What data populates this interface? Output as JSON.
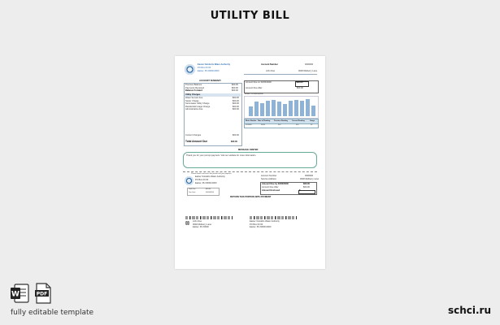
{
  "page_title": "UTILITY BILL",
  "footer": {
    "left_text": "fully editable template",
    "site": "schci.ru"
  },
  "icons": {
    "word": "word-icon",
    "pdf": "pdf-icon"
  },
  "doc": {
    "company_name": "Easter Outskirts Water Authority",
    "company_address": "PO Box 00 00",
    "company_city": "Easter, Pk 00000-0000",
    "account_number_label": "Account Number",
    "account_number_value": "0000000",
    "customer_name": "John Doe",
    "customer_address": "0000 Mulberry Lane",
    "account_summary_title": "ACCOUNT SUMMARY",
    "summary_rows": [
      {
        "label": "Previous Balance",
        "value": "$00.00"
      },
      {
        "label": "Payments Received",
        "value": "$00.00"
      },
      {
        "label": "Balance Forward",
        "value": "$00.00"
      }
    ],
    "charges_title": "Utility Charges",
    "charges_rows": [
      {
        "label": "Water Service Fee",
        "value": "$00.00"
      },
      {
        "label": "Sewer Charge",
        "value": "$00.00"
      },
      {
        "label": "Stormwater Utility Charge",
        "value": "$00.00"
      },
      {
        "label": "Residential Usage Charge",
        "value": "$00.00"
      },
      {
        "label": "Administrative Fee",
        "value": "$00.00"
      }
    ],
    "current_charges_label": "Current Charges",
    "current_charges_value": "$00.00",
    "total_due_label": "Total Amount Due",
    "total_due_value": "$00.00",
    "amount_due_label": "Amount Due on 00/00/0000",
    "amount_due_value": "$00.00",
    "amount_after_label": "Amount Due After",
    "amount_after_value": "$00.00",
    "usage_title": "Water Consumption",
    "usage_bars": [
      0.55,
      0.8,
      0.75,
      0.85,
      0.9,
      0.8,
      0.7,
      0.85,
      0.9,
      0.88,
      0.95,
      0.6
    ],
    "usage_table_headers": [
      "Meter Number",
      "Date of Reading",
      "Previous Reading",
      "Current Reading",
      "Usage"
    ],
    "usage_table_values": [
      "0000000",
      "00/00",
      "000",
      "000",
      "00"
    ],
    "message_title": "MESSAGE CENTER",
    "message_text": "Thank you for your prompt payment. Visit our website for more information.",
    "cut_line": "Please detach and return this portion with your payment",
    "stub_company_name": "Easter Outskirts Water Authority",
    "stub_address": "PO Box 00 00",
    "stub_city": "Easter, Pk 00000-0000",
    "stub_account_label": "Account Number",
    "stub_account_value": "0000000",
    "stub_service_label": "Service Address",
    "stub_service_value": "0000 Mulberry Lane",
    "stub_due_label": "Amount Due by 00/00/0000",
    "stub_due_value": "$00.00",
    "stub_after_label": "Amount Due After",
    "stub_after_value": "$00.00",
    "stub_enclosed_label": "Amount Enclosed",
    "stub_enclosed_value": "$",
    "stub_small_rows": [
      {
        "label": "Total Due",
        "value": "$00.00"
      },
      {
        "label": "Due Date",
        "value": "00/00/0000"
      }
    ],
    "return_label": "RETURN THIS PORTION WITH PAYMENT",
    "mail_to_name": "John Doe",
    "mail_to_address": "0000 Mulberry Lane",
    "mail_to_city": "Easter, Pk 00000",
    "remit_name": "Easter Outskirts Water Authority",
    "remit_address": "PO Box 00 00",
    "remit_city": "Easter, Pk 00000-0000"
  }
}
